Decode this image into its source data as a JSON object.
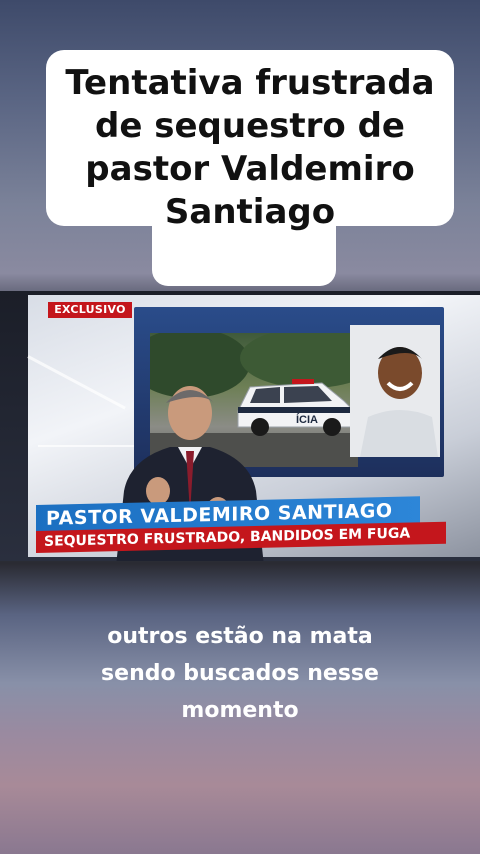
{
  "title": {
    "lines": [
      "Tentativa frustrada",
      "de sequestro de",
      "pastor Valdemiro",
      "Santiago"
    ]
  },
  "tv": {
    "badge": "EXCLUSIVO",
    "headline": "PASTOR VALDEMIRO SANTIAGO",
    "subheadline": "SEQUESTRO FRUSTRADO, BANDIDOS EM FUGA",
    "police_car_text": "ÍCIA"
  },
  "caption": {
    "lines": [
      "outros estão na mata",
      "sendo buscados nesse",
      "momento"
    ]
  },
  "colors": {
    "badge_red": "#c4161c",
    "headline_blue": "#1b6fc1"
  }
}
